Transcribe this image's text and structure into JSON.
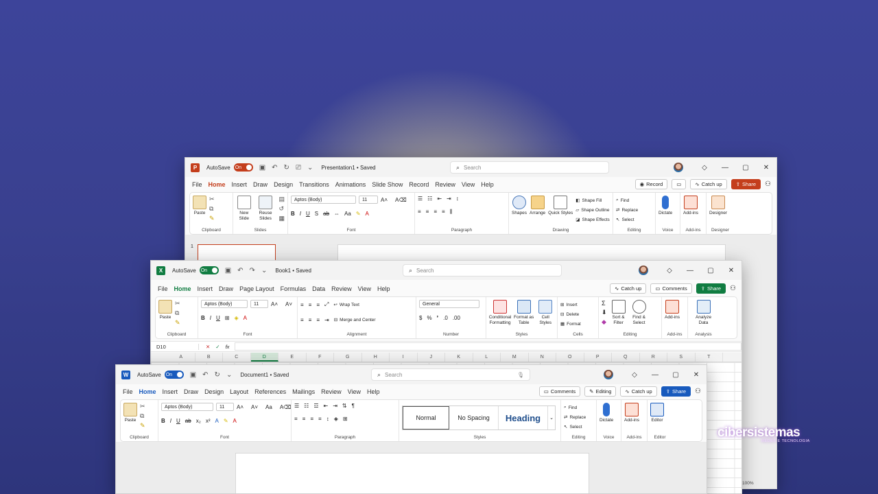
{
  "colors": {
    "powerpoint": "#c43e1c",
    "excel": "#107c41",
    "word": "#185abd"
  },
  "powerpoint": {
    "autosave_label": "AutoSave",
    "toggle_label": "On",
    "doc_title": "Presentation1 • Saved",
    "search_placeholder": "Search",
    "tabs": [
      "File",
      "Home",
      "Insert",
      "Draw",
      "Design",
      "Transitions",
      "Animations",
      "Slide Show",
      "Record",
      "Review",
      "View",
      "Help"
    ],
    "record_button": "Record",
    "catchup_button": "Catch up",
    "share_button": "Share",
    "paste_label": "Paste",
    "new_slide_label": "New Slide",
    "reuse_slides_label": "Reuse Slides",
    "font_name": "Aptos (Body)",
    "font_size": "11",
    "shapes_label": "Shapes",
    "arrange_label": "Arrange",
    "quick_styles_label": "Quick Styles",
    "shape_fill": "Shape Fill",
    "shape_outline": "Shape Outline",
    "shape_effects": "Shape Effects",
    "find": "Find",
    "replace": "Replace",
    "select": "Select",
    "dictate": "Dictate",
    "addins": "Add-ins",
    "designer": "Designer",
    "groups": [
      "Clipboard",
      "Slides",
      "Font",
      "Paragraph",
      "Drawing",
      "Editing",
      "Voice",
      "Add-ins",
      "Designer"
    ],
    "slide_number": "1"
  },
  "excel": {
    "autosave_label": "AutoSave",
    "toggle_label": "On",
    "doc_title": "Book1 • Saved",
    "search_placeholder": "Search",
    "tabs": [
      "File",
      "Home",
      "Insert",
      "Draw",
      "Page Layout",
      "Formulas",
      "Data",
      "Review",
      "View",
      "Help"
    ],
    "catchup_button": "Catch up",
    "comments_button": "Comments",
    "share_button": "Share",
    "paste_label": "Paste",
    "font_name": "Aptos (Body)",
    "font_size": "11",
    "wrap_text": "Wrap Text",
    "merge_center": "Merge and Center",
    "number_format": "General",
    "conditional_formatting": "Conditional Formatting",
    "format_as_table": "Format as Table",
    "cell_styles": "Cell Styles",
    "insert": "Insert",
    "delete": "Delete",
    "format": "Format",
    "sort_filter": "Sort & Filter",
    "find_select": "Find & Select",
    "addins": "Add-ins",
    "analyze_data": "Analyze Data",
    "groups": [
      "Clipboard",
      "Font",
      "Alignment",
      "Number",
      "Styles",
      "Cells",
      "Editing",
      "Add-ins",
      "Analysis"
    ],
    "name_box": "D10",
    "fx": "fx",
    "columns": [
      "A",
      "B",
      "C",
      "D",
      "E",
      "F",
      "G",
      "H",
      "I",
      "J",
      "K",
      "L",
      "M",
      "N",
      "O",
      "P",
      "Q",
      "R",
      "S",
      "T"
    ],
    "zoom": "100%"
  },
  "word": {
    "autosave_label": "AutoSave",
    "toggle_label": "On",
    "doc_title": "Document1 • Saved",
    "search_placeholder": "Search",
    "tabs": [
      "File",
      "Home",
      "Insert",
      "Draw",
      "Design",
      "Layout",
      "References",
      "Mailings",
      "Review",
      "View",
      "Help"
    ],
    "comments_button": "Comments",
    "editing_button": "Editing",
    "catchup_button": "Catch up",
    "share_button": "Share",
    "paste_label": "Paste",
    "font_name": "Aptos (Body)",
    "font_size": "11",
    "styles": [
      "Normal",
      "No Spacing",
      "Heading"
    ],
    "find": "Find",
    "replace": "Replace",
    "select": "Select",
    "dictate": "Dictate",
    "addins": "Add-ins",
    "editor": "Editor",
    "groups": [
      "Clipboard",
      "Font",
      "Paragraph",
      "Styles",
      "Editing",
      "Voice",
      "Add-ins",
      "Editor"
    ]
  },
  "watermark": {
    "brand": "cibersistemas",
    "tagline": "REDES E TECNOLOGIA"
  }
}
